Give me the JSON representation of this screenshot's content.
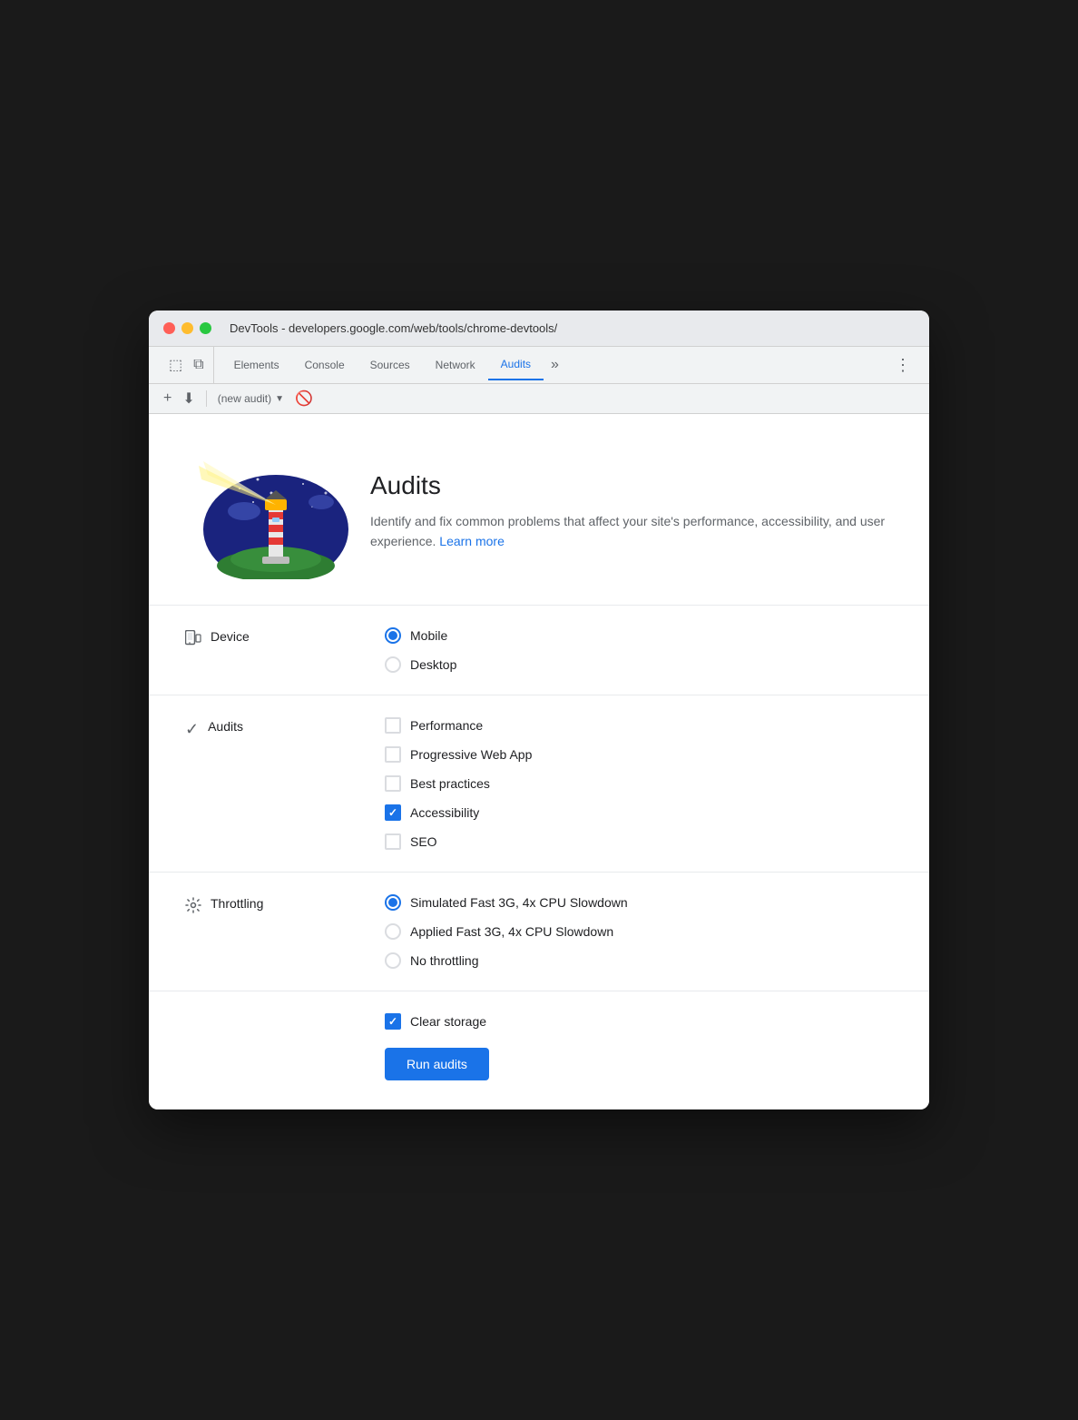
{
  "window": {
    "title": "DevTools - developers.google.com/web/tools/chrome-devtools/"
  },
  "tabs": {
    "items": [
      {
        "label": "Elements",
        "active": false
      },
      {
        "label": "Console",
        "active": false
      },
      {
        "label": "Sources",
        "active": false
      },
      {
        "label": "Network",
        "active": false
      },
      {
        "label": "Audits",
        "active": true
      }
    ],
    "more_label": "»",
    "menu_dots": "⋮"
  },
  "subtoolbar": {
    "audit_select": "(new audit)",
    "stop_icon": "🚫"
  },
  "hero": {
    "title": "Audits",
    "description": "Identify and fix common problems that affect your site's performance, accessibility, and user experience.",
    "learn_more": "Learn more"
  },
  "device_section": {
    "label": "Device",
    "options": [
      {
        "label": "Mobile",
        "selected": true
      },
      {
        "label": "Desktop",
        "selected": false
      }
    ]
  },
  "audits_section": {
    "label": "Audits",
    "options": [
      {
        "label": "Performance",
        "checked": false
      },
      {
        "label": "Progressive Web App",
        "checked": false
      },
      {
        "label": "Best practices",
        "checked": false
      },
      {
        "label": "Accessibility",
        "checked": true
      },
      {
        "label": "SEO",
        "checked": false
      }
    ]
  },
  "throttling_section": {
    "label": "Throttling",
    "options": [
      {
        "label": "Simulated Fast 3G, 4x CPU Slowdown",
        "selected": true
      },
      {
        "label": "Applied Fast 3G, 4x CPU Slowdown",
        "selected": false
      },
      {
        "label": "No throttling",
        "selected": false
      }
    ]
  },
  "bottom": {
    "clear_storage_label": "Clear storage",
    "clear_storage_checked": true,
    "run_button": "Run audits"
  },
  "colors": {
    "accent": "#1a73e8",
    "text_primary": "#202124",
    "text_secondary": "#5f6368"
  }
}
